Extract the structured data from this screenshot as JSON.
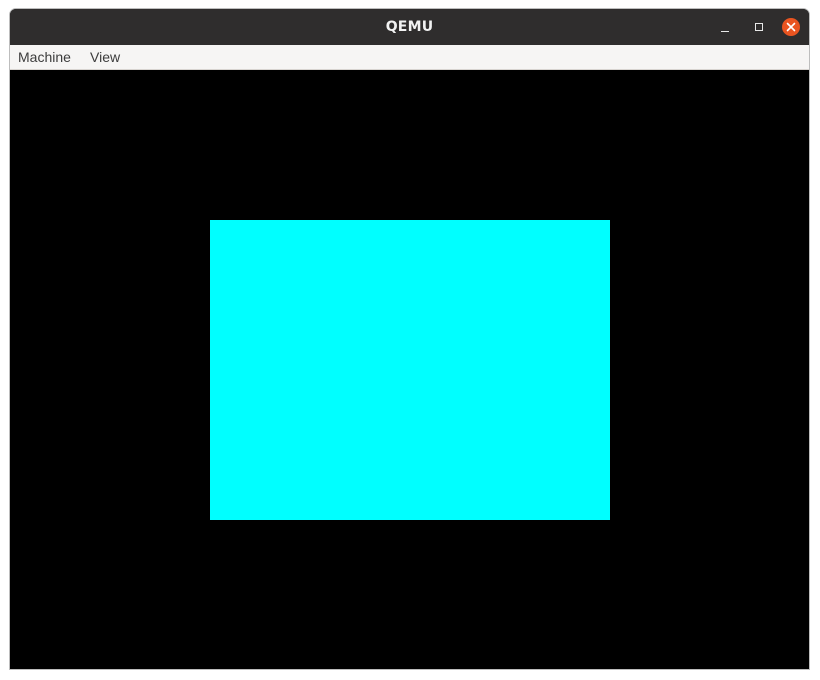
{
  "window": {
    "title": "QEMU",
    "controls": {
      "minimize_icon": "minimize-icon",
      "maximize_icon": "maximize-icon",
      "close_icon": "close-icon",
      "close_color": "#e95420"
    }
  },
  "menubar": {
    "items": [
      {
        "label": "Machine"
      },
      {
        "label": "View"
      }
    ]
  },
  "display": {
    "background_color": "#000000",
    "shape": {
      "type": "rectangle",
      "fill_color": "#00ffff"
    }
  }
}
